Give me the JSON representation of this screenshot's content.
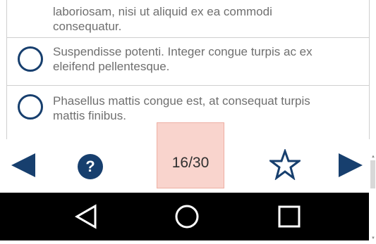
{
  "question": {
    "partial_text": "laboriosam, nisi ut aliquid ex ea commodi consequatur.",
    "options": [
      {
        "label": "Suspendisse potenti. Integer congue turpis ac ex eleifend pellentesque."
      },
      {
        "label": "Phasellus mattis congue est, at consequat turpis mattis finibus."
      }
    ]
  },
  "navigation": {
    "counter": "16/30",
    "help_glyph": "?",
    "prev_icon": "triangle-left-icon",
    "next_icon": "triangle-right-icon",
    "favorite_icon": "star-outline-icon"
  },
  "system_nav": {
    "back_icon": "back-triangle-icon",
    "home_icon": "home-circle-icon",
    "recents_icon": "recents-square-icon"
  },
  "colors": {
    "accent": "#173f6e",
    "text": "#6f6f6f",
    "highlight": "#f4aa9b",
    "system_bar": "#000000"
  }
}
